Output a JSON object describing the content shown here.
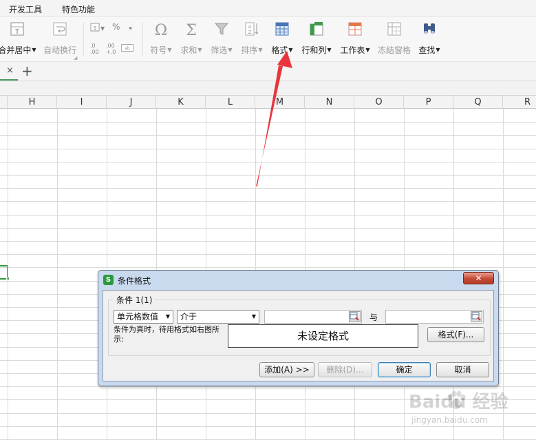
{
  "menu": {
    "tabs": [
      "开发工具",
      "特色功能"
    ]
  },
  "ribbon": {
    "merge_center": "合并居中",
    "wrap_text": "自动换行",
    "percent": "%",
    "comma": "❟",
    "decimal_increase": ".0 .00",
    "decimal_decrease": ".00 +.0",
    "symbol": "符号",
    "sum": "求和",
    "filter": "筛选",
    "sort": "排序",
    "format": "格式",
    "rows_cols": "行和列",
    "worksheet": "工作表",
    "freeze": "冻结窗格",
    "find": "查找"
  },
  "tabs": {
    "close": "×",
    "add": "+"
  },
  "sheet": {
    "columns": [
      "H",
      "I",
      "J",
      "K",
      "L",
      "M",
      "N",
      "O",
      "P",
      "Q",
      "R"
    ]
  },
  "dialog": {
    "title": "条件格式",
    "close": "✕",
    "group_label": "条件 1(1)",
    "condition_type": "单元格数值",
    "operator": "介于",
    "value1": "",
    "and_label": "与",
    "value2": "",
    "preview_desc": "条件为真时，待用格式如右图所示:",
    "preview_text": "未设定格式",
    "format_button": "格式(F)...",
    "add_button": "添加(A) >>",
    "delete_button": "删除(D)...",
    "ok_button": "确定",
    "cancel_button": "取消"
  },
  "watermark": {
    "brand": "Baidu 经验",
    "url": "jingyan.baidu.com"
  },
  "colors": {
    "accent": "#2f9a3f",
    "annotation_arrow": "#e8363c"
  }
}
